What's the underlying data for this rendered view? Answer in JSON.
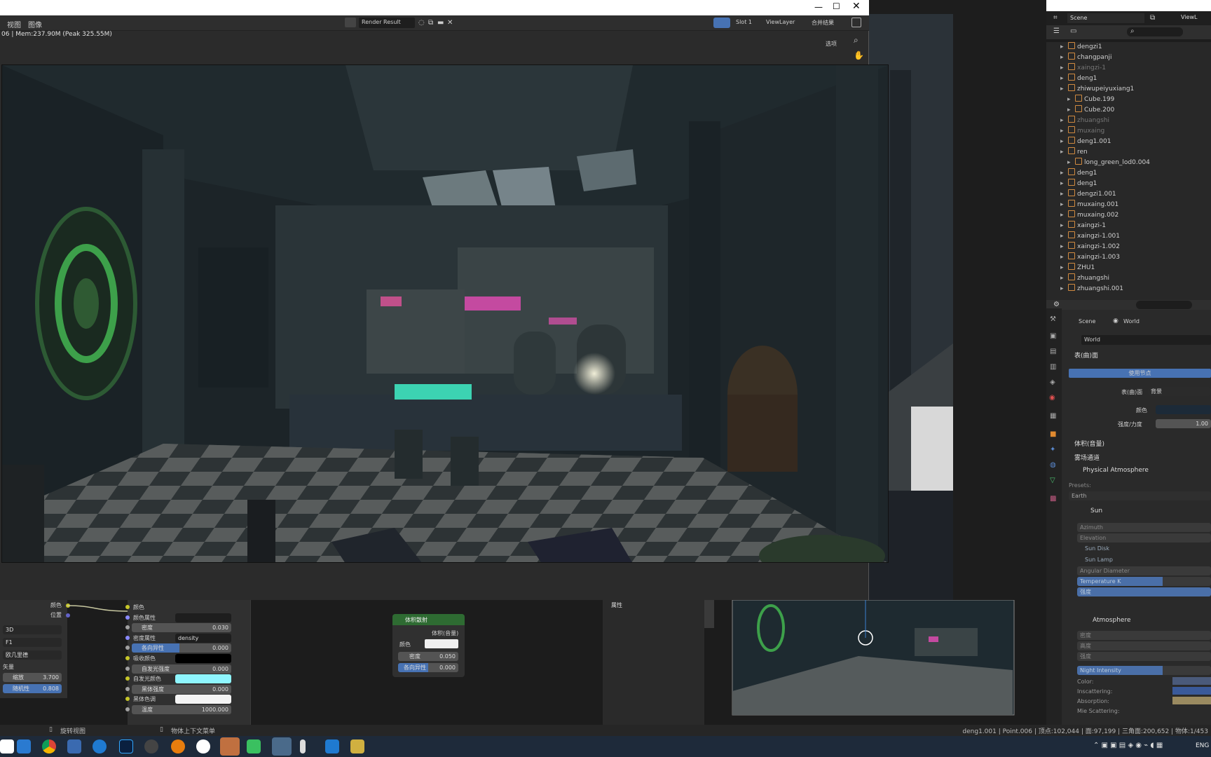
{
  "render_window": {
    "menus": [
      "视图",
      "图像"
    ],
    "image_name": "Render Result",
    "slot": "Slot 1",
    "view_layer": "ViewLayer",
    "pass": "合并结果",
    "mem_info": "06 | Mem:237.90M (Peak 325.55M)",
    "options": "选项"
  },
  "top_right": {
    "scene": "Scene",
    "view_layer": "ViewL"
  },
  "outliner": {
    "items": [
      {
        "label": "dengzi1",
        "dim": false
      },
      {
        "label": "changpanji",
        "dim": false
      },
      {
        "label": "xaingzi-1",
        "dim": true
      },
      {
        "label": "deng1",
        "dim": false
      },
      {
        "label": "zhiwupeiyuxiang1",
        "dim": false
      },
      {
        "label": "Cube.199",
        "dim": false
      },
      {
        "label": "Cube.200",
        "dim": false
      },
      {
        "label": "zhuangshi",
        "dim": true
      },
      {
        "label": "muxaing",
        "dim": true
      },
      {
        "label": "deng1.001",
        "dim": false
      },
      {
        "label": "ren",
        "dim": false
      },
      {
        "label": "long_green_lod0.004",
        "dim": false
      },
      {
        "label": "deng1",
        "dim": false
      },
      {
        "label": "deng1",
        "dim": false
      },
      {
        "label": "dengzi1.001",
        "dim": false
      },
      {
        "label": "muxaing.001",
        "dim": false
      },
      {
        "label": "muxaing.002",
        "dim": false
      },
      {
        "label": "xaingzi-1",
        "dim": false
      },
      {
        "label": "xaingzi-1.001",
        "dim": false
      },
      {
        "label": "xaingzi-1.002",
        "dim": false
      },
      {
        "label": "xaingzi-1.003",
        "dim": false
      },
      {
        "label": "ZHU1",
        "dim": false
      },
      {
        "label": "zhuangshi",
        "dim": false
      },
      {
        "label": "zhuangshi.001",
        "dim": false
      }
    ]
  },
  "properties": {
    "breadcrumb_scene": "Scene",
    "breadcrumb_world": "World",
    "world_name": "World",
    "surface_panel": "表(曲)面",
    "use_nodes": "使用节点",
    "surface_label": "表(曲)面",
    "surface_value": "背景",
    "color_label": "颜色",
    "strength_label": "强度/力度",
    "strength_value": "1.00",
    "volume_panel": "体积(音量)",
    "light_path_panel": "雾场通道",
    "physical_atmosphere": "Physical Atmosphere",
    "presets_label": "Presets:",
    "presets_value": "Earth",
    "sun_panel": "Sun",
    "azimuth": "Azimuth",
    "elevation": "Elevation",
    "sun_disk": "Sun Disk",
    "sun_lamp": "Sun Lamp",
    "angular_diameter": "Angular Diameter",
    "temperature": "Temperature K",
    "intensity": "强度",
    "atmosphere_panel": "Atmosphere",
    "density_a": "密度",
    "density_b": "高度",
    "density_c": "强度",
    "night_intensity": "Night Intensity",
    "color": "Color:",
    "inscattering": "Inscattering:",
    "absorption": "Absorption:",
    "mie": "Mie Scattering:"
  },
  "node_editor": {
    "left_panel": {
      "out_color": "颜色",
      "out_position": "位置",
      "dim": "3D",
      "metric": "F1",
      "distance": "欧几里德",
      "vector": "矢量",
      "scale_label": "缩放",
      "scale_value": "3.700",
      "random_label": "随机性",
      "random_value": "0.808"
    },
    "principled_volume": {
      "rows": [
        {
          "label": "颜色",
          "value": "",
          "kind": "socket"
        },
        {
          "label": "颜色属性",
          "value": "",
          "kind": "dark"
        },
        {
          "label": "密度",
          "value": "0.030",
          "kind": "num"
        },
        {
          "label": "密度属性",
          "value": "density",
          "kind": "dark"
        },
        {
          "label": "各向异性",
          "value": "0.000",
          "kind": "blue"
        },
        {
          "label": "吸收颜色",
          "value": "",
          "kind": "black"
        },
        {
          "label": "自发光强度",
          "value": "0.000",
          "kind": "num"
        },
        {
          "label": "自发光颜色",
          "value": "",
          "kind": "cyan"
        },
        {
          "label": "黑体强度",
          "value": "0.000",
          "kind": "num"
        },
        {
          "label": "黑体色调",
          "value": "",
          "kind": "white"
        },
        {
          "label": "温度",
          "value": "1000.000",
          "kind": "num"
        }
      ]
    },
    "volume_scatter": {
      "title": "体积散射",
      "output": "体积(音量)",
      "color_label": "颜色",
      "density_label": "密度",
      "density_value": "0.050",
      "anisotropy_label": "各向异性",
      "anisotropy_value": "0.000"
    },
    "attributes_label": "属性"
  },
  "status_bar": {
    "left_hint": "旋转视图",
    "mid_hint": "物体上下文菜单",
    "stats": "deng1.001 | Point.006 | 顶点:102,044 | 面:97,199 | 三角面:200,652 | 物体:1/453"
  },
  "taskbar": {
    "lang": "ENG"
  },
  "colors": {
    "accent_blue": "#4772b3",
    "node_green": "#2e6b32",
    "cyan_swatch": "#8ff6ff"
  }
}
